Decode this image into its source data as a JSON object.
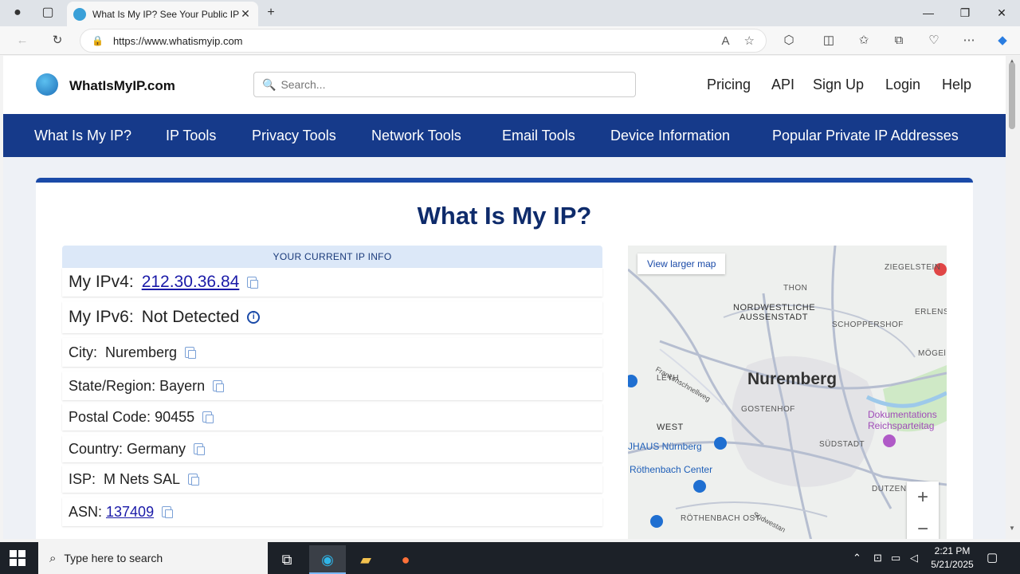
{
  "browser": {
    "tab_title": "What Is My IP? See Your Public IP",
    "url": "https://www.whatismyip.com"
  },
  "site": {
    "brand": "WhatIsMyIP.com",
    "search_placeholder": "Search...",
    "top_links": [
      "Pricing",
      "API",
      "Sign Up",
      "Login",
      "Help"
    ],
    "nav": [
      "What Is My IP?",
      "IP Tools",
      "Privacy Tools",
      "Network Tools",
      "Email Tools",
      "Device Information",
      "Popular Private IP Addresses"
    ]
  },
  "main": {
    "title": "What Is My IP?",
    "ip_info_header": "YOUR CURRENT IP INFO",
    "rows": [
      {
        "label": "My IPv4:",
        "value": "212.30.36.84"
      },
      {
        "label": "My IPv6:",
        "value": "Not Detected"
      },
      {
        "label": "City:",
        "value": "Nuremberg"
      },
      {
        "label": "State/Region:",
        "value": "Bayern"
      },
      {
        "label": "Postal Code:",
        "value": "90455"
      },
      {
        "label": "Country:",
        "value": "Germany"
      },
      {
        "label": "ISP:",
        "value": "M Nets SAL"
      },
      {
        "label": "ASN:",
        "value": "137409"
      }
    ]
  },
  "map": {
    "button": "View larger map",
    "labels": {
      "city": "Nuremberg",
      "ziegelstein": "ZIEGELSTEIN",
      "thon": "THON",
      "nordwest": "NORDWESTLICHE",
      "aussenstadt": "AUSSENSTADT",
      "erlens": "ERLENS",
      "schoppershof": "SCHOPPERSHOF",
      "moegel": "MÖGEl",
      "leyh": "LEYH",
      "gostenhof": "GOSTENHOF",
      "west": "WEST",
      "dokumentations": "Dokumentations",
      "reichsparteitag": "Reichsparteitag",
      "suedstadt": "SÜDSTADT",
      "haus": "JHAUS Nürnberg",
      "roethenbach_center": "Röthenbach Center",
      "roethenbach_ost": "RÖTHENBACH OST",
      "dutzend": "DUTZEN",
      "frankenschnellweg": "Frankenschnellweg",
      "suedwest": "Südwestan"
    },
    "zoom_in": "+",
    "zoom_out": "−"
  },
  "taskbar": {
    "search_placeholder": "Type here to search",
    "time": "2:21 PM",
    "date": "5/21/2025"
  },
  "colors": {
    "nav_bg": "#163a8a",
    "title": "#0e2b6b",
    "card_top": "#1a4aa8"
  }
}
